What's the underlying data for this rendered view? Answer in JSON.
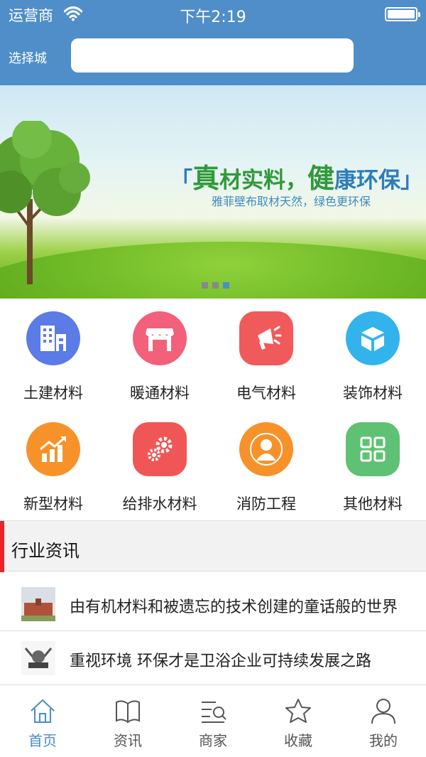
{
  "status_bar": {
    "carrier": "运营商",
    "time": "下午2:19"
  },
  "header": {
    "city_label": "选择城",
    "search_value": "",
    "search_placeholder": ""
  },
  "banner": {
    "slogan_open": "「",
    "slogan_a1": "真",
    "slogan_a2": "材实料，",
    "slogan_b1": "健",
    "slogan_b2": "康环保",
    "slogan_close": "」",
    "subtitle": "雅菲壁布取材天然，绿色更环保",
    "page_count": 3,
    "active_page": 3
  },
  "categories": [
    {
      "label": "土建材料",
      "icon": "building-icon",
      "color": "#5b7be6"
    },
    {
      "label": "暖通材料",
      "icon": "storefront-icon",
      "color": "#f2607a"
    },
    {
      "label": "电气材料",
      "icon": "megaphone-icon",
      "color": "#f05a5a"
    },
    {
      "label": "装饰材料",
      "icon": "box-icon",
      "color": "#33b3ec"
    },
    {
      "label": "新型材料",
      "icon": "growth-chart-icon",
      "color": "#f7922a"
    },
    {
      "label": "给排水材料",
      "icon": "gears-icon",
      "color": "#f15656"
    },
    {
      "label": "消防工程",
      "icon": "person-icon",
      "color": "#f7922a"
    },
    {
      "label": "其他材料",
      "icon": "grid-icon",
      "color": "#5fc173"
    }
  ],
  "news": {
    "section_title": "行业资讯",
    "items": [
      {
        "title": "由有机材料和被遗忘的技术创建的童话般的世界",
        "thumb": "building-photo"
      },
      {
        "title": "重视环境 环保才是卫浴企业可持续发展之路",
        "thumb": "emblem-photo"
      }
    ]
  },
  "tabbar": {
    "active_index": 0,
    "active_color": "#4a8cc8",
    "items": [
      {
        "label": "首页",
        "icon": "home-icon"
      },
      {
        "label": "资讯",
        "icon": "book-icon"
      },
      {
        "label": "商家",
        "icon": "merchant-search-icon"
      },
      {
        "label": "收藏",
        "icon": "star-icon"
      },
      {
        "label": "我的",
        "icon": "user-icon"
      }
    ]
  }
}
